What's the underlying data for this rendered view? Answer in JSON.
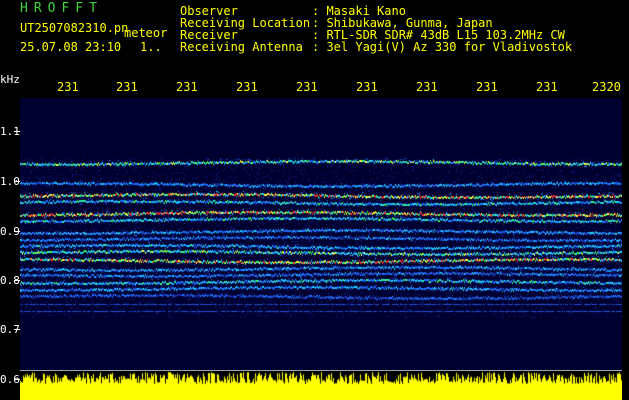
{
  "header": {
    "station": "HROFFT",
    "filename": "UT2507082310.pn",
    "type": "meteor",
    "datetime": "25.07.08 23:10",
    "page": "1.."
  },
  "info": {
    "labels": [
      "Observer",
      "Receiving Location",
      "Receiver",
      "Receiving Antenna"
    ],
    "values": [
      ": Masaki Kano",
      ": Shibukawa, Gunma, Japan",
      ": RTL-SDR SDR# 43dB L15 103.2MHz CW",
      ": 3el Yagi(V) Az 330 for Vladivostok"
    ]
  },
  "y_axis": {
    "unit": "kHz",
    "ticks": [
      "1.1",
      "1.0",
      "0.9",
      "0.8",
      "0.7",
      "0.6"
    ]
  },
  "x_axis": {
    "ticks": [
      "231",
      "231",
      "231",
      "231",
      "231",
      "231",
      "231",
      "231",
      "231",
      "2320"
    ]
  },
  "colors": {
    "background": "#000000",
    "plot_background": "#000030",
    "label_yellow": "#ffff00",
    "station_green": "#3fd43f",
    "bottom_bars": "#ffff00"
  }
}
